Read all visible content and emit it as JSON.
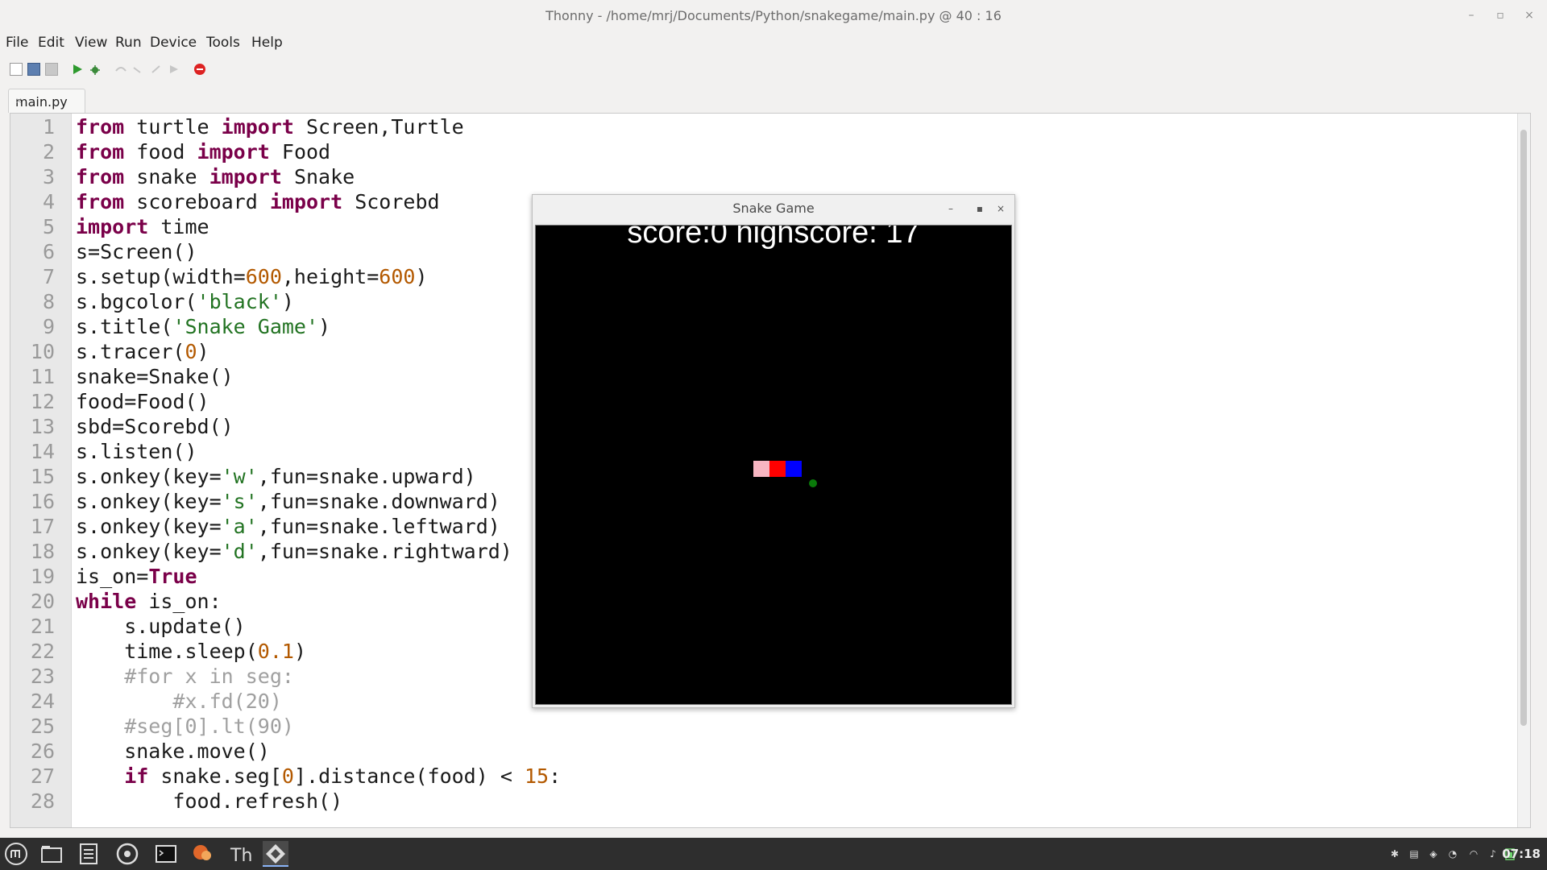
{
  "window": {
    "title": "Thonny  -  /home/mrj/Documents/Python/snakegame/main.py  @  40 : 16"
  },
  "menu": [
    "File",
    "Edit",
    "View",
    "Run",
    "Device",
    "Tools",
    "Help"
  ],
  "tab": {
    "label": "main.py"
  },
  "editor": {
    "lines": [
      [
        [
          "kw",
          "from"
        ],
        [
          "t",
          " turtle "
        ],
        [
          "kw",
          "import"
        ],
        [
          "t",
          " Screen,Turtle"
        ]
      ],
      [
        [
          "kw",
          "from"
        ],
        [
          "t",
          " food "
        ],
        [
          "kw",
          "import"
        ],
        [
          "t",
          " Food"
        ]
      ],
      [
        [
          "kw",
          "from"
        ],
        [
          "t",
          " snake "
        ],
        [
          "kw",
          "import"
        ],
        [
          "t",
          " Snake"
        ]
      ],
      [
        [
          "kw",
          "from"
        ],
        [
          "t",
          " scoreboard "
        ],
        [
          "kw",
          "import"
        ],
        [
          "t",
          " Scorebd"
        ]
      ],
      [
        [
          "kw",
          "import"
        ],
        [
          "t",
          " time"
        ]
      ],
      [
        [
          "t",
          "s=Screen()"
        ]
      ],
      [
        [
          "t",
          "s.setup(width="
        ],
        [
          "num",
          "600"
        ],
        [
          "t",
          ",height="
        ],
        [
          "num",
          "600"
        ],
        [
          "t",
          ")"
        ]
      ],
      [
        [
          "t",
          "s.bgcolor("
        ],
        [
          "str",
          "'black'"
        ],
        [
          "t",
          ")"
        ]
      ],
      [
        [
          "t",
          "s.title("
        ],
        [
          "str",
          "'Snake Game'"
        ],
        [
          "t",
          ")"
        ]
      ],
      [
        [
          "t",
          "s.tracer("
        ],
        [
          "num",
          "0"
        ],
        [
          "t",
          ")"
        ]
      ],
      [
        [
          "t",
          "snake=Snake()"
        ]
      ],
      [
        [
          "t",
          "food=Food()"
        ]
      ],
      [
        [
          "t",
          "sbd=Scorebd()"
        ]
      ],
      [
        [
          "t",
          "s.listen()"
        ]
      ],
      [
        [
          "t",
          "s.onkey(key="
        ],
        [
          "str",
          "'w'"
        ],
        [
          "t",
          ",fun=snake.upward)"
        ]
      ],
      [
        [
          "t",
          "s.onkey(key="
        ],
        [
          "str",
          "'s'"
        ],
        [
          "t",
          ",fun=snake.downward)"
        ]
      ],
      [
        [
          "t",
          "s.onkey(key="
        ],
        [
          "str",
          "'a'"
        ],
        [
          "t",
          ",fun=snake.leftward)"
        ]
      ],
      [
        [
          "t",
          "s.onkey(key="
        ],
        [
          "str",
          "'d'"
        ],
        [
          "t",
          ",fun=snake.rightward)"
        ]
      ],
      [
        [
          "t",
          "is_on="
        ],
        [
          "kw",
          "True"
        ]
      ],
      [
        [
          "kw",
          "while"
        ],
        [
          "t",
          " is_on:"
        ]
      ],
      [
        [
          "t",
          "    s.update()"
        ]
      ],
      [
        [
          "t",
          "    time.sleep("
        ],
        [
          "num",
          "0.1"
        ],
        [
          "t",
          ")"
        ]
      ],
      [
        [
          "com",
          "    #for x in seg:"
        ]
      ],
      [
        [
          "com",
          "        #x.fd(20)"
        ]
      ],
      [
        [
          "com",
          "    #seg[0].lt(90)"
        ]
      ],
      [
        [
          "t",
          "    snake.move()"
        ]
      ],
      [
        [
          "t",
          "    "
        ],
        [
          "kw",
          "if"
        ],
        [
          "t",
          " snake.seg["
        ],
        [
          "num",
          "0"
        ],
        [
          "t",
          "].distance(food) < "
        ],
        [
          "num",
          "15"
        ],
        [
          "t",
          ":"
        ]
      ],
      [
        [
          "t",
          "        food.refresh()"
        ]
      ]
    ]
  },
  "game": {
    "title": "Snake Game",
    "score_text": "score:0 highscore: 17",
    "segment_colors": [
      "#f7b6c2",
      "#ff0000",
      "#0000ff"
    ],
    "food_color": "#0a7a0a"
  },
  "taskbar": {
    "clock": "07:18"
  }
}
